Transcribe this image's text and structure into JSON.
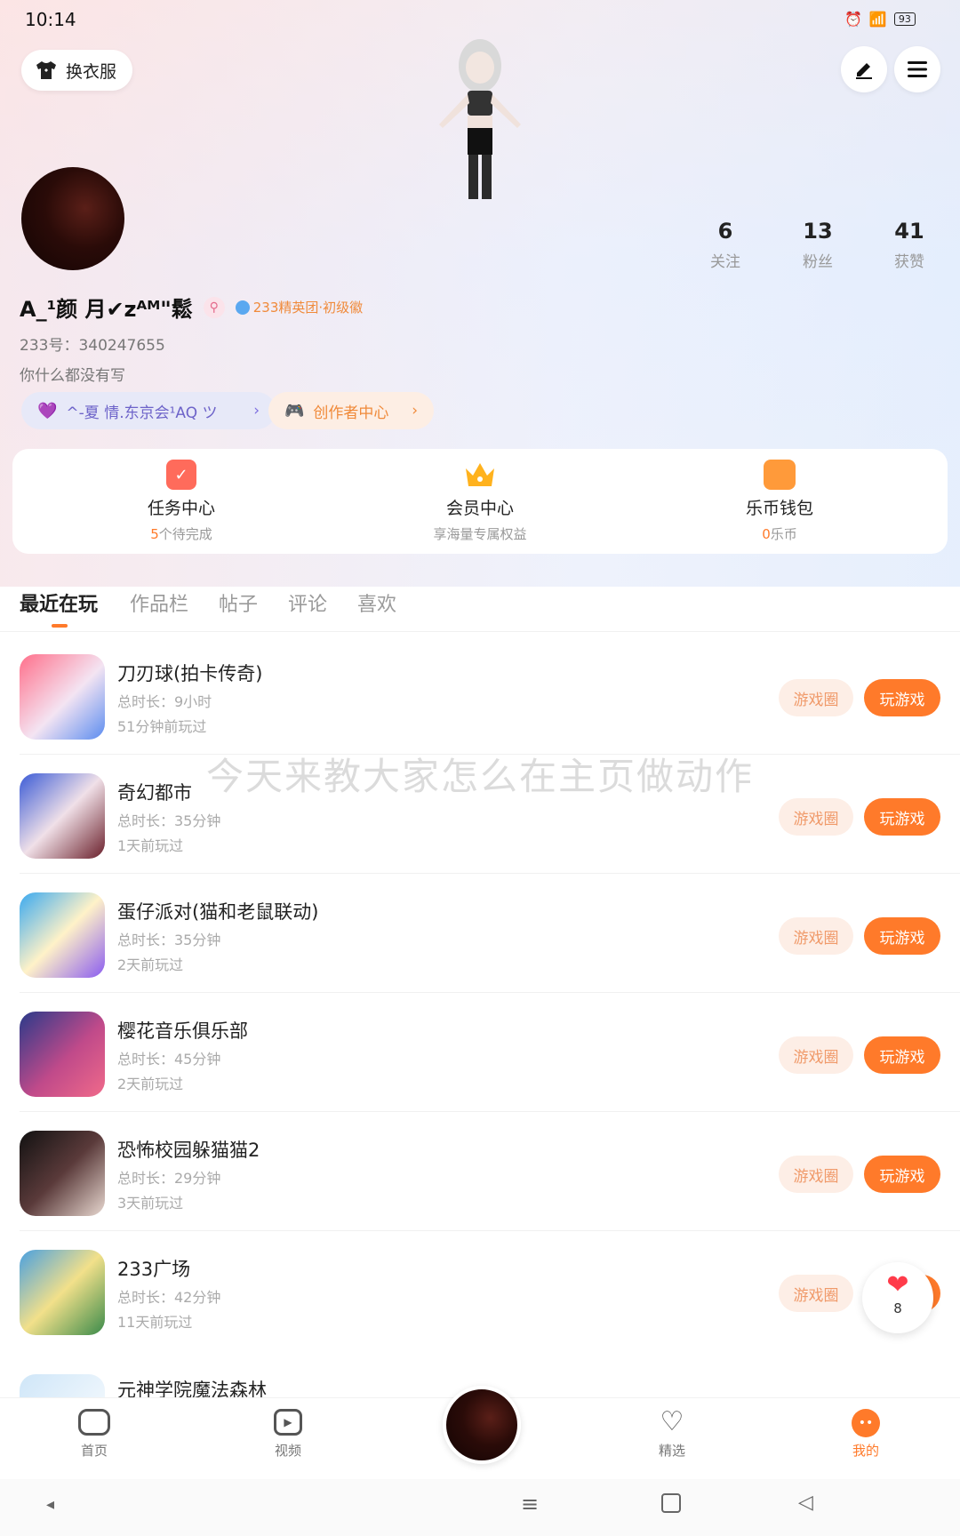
{
  "status_bar": {
    "time": "10:14",
    "battery": "93"
  },
  "header": {
    "outfit_label": "换衣服",
    "username": "A_¹颜 月✔zᴬᴹ\"鬆",
    "badge": "233精英团·初级徽",
    "id_text": "233号：340247655",
    "bio": "你什么都没有写",
    "family_chip": "^-夏 情.东京会¹AQ ツ",
    "creator_chip": "创作者中心",
    "stats": [
      {
        "num": "6",
        "label": "关注"
      },
      {
        "num": "13",
        "label": "粉丝"
      },
      {
        "num": "41",
        "label": "获赞"
      }
    ]
  },
  "quick_cards": [
    {
      "title": "任务中心",
      "sub_num": "5",
      "sub": "个待完成"
    },
    {
      "title": "会员中心",
      "sub_num": "",
      "sub": "享海量专属权益"
    },
    {
      "title": "乐币钱包",
      "sub_num": "0",
      "sub": "乐币"
    }
  ],
  "tabs": [
    "最近在玩",
    "作品栏",
    "帖子",
    "评论",
    "喜欢"
  ],
  "games": [
    {
      "name": "刀刃球(拍卡传奇)",
      "duration": "总时长：9小时",
      "ago": "51分钟前玩过"
    },
    {
      "name": "奇幻都市",
      "duration": "总时长：35分钟",
      "ago": "1天前玩过"
    },
    {
      "name": "蛋仔派对(猫和老鼠联动)",
      "duration": "总时长：35分钟",
      "ago": "2天前玩过"
    },
    {
      "name": "樱花音乐俱乐部",
      "duration": "总时长：45分钟",
      "ago": "2天前玩过"
    },
    {
      "name": "恐怖校园躲猫猫2",
      "duration": "总时长：29分钟",
      "ago": "3天前玩过"
    },
    {
      "name": "233广场",
      "duration": "总时长：42分钟",
      "ago": "11天前玩过"
    },
    {
      "name": "元神学院魔法森林",
      "duration": "",
      "ago": ""
    }
  ],
  "buttons": {
    "circle": "游戏圈",
    "play": "玩游戏"
  },
  "watermark": "今天来教大家怎么在主页做动作",
  "like_count": "8",
  "nav": [
    "首页",
    "视频",
    "精选",
    "我的"
  ],
  "colors": {
    "accent": "#ff7a2a",
    "tab_indicator": "#ff7a2a"
  }
}
